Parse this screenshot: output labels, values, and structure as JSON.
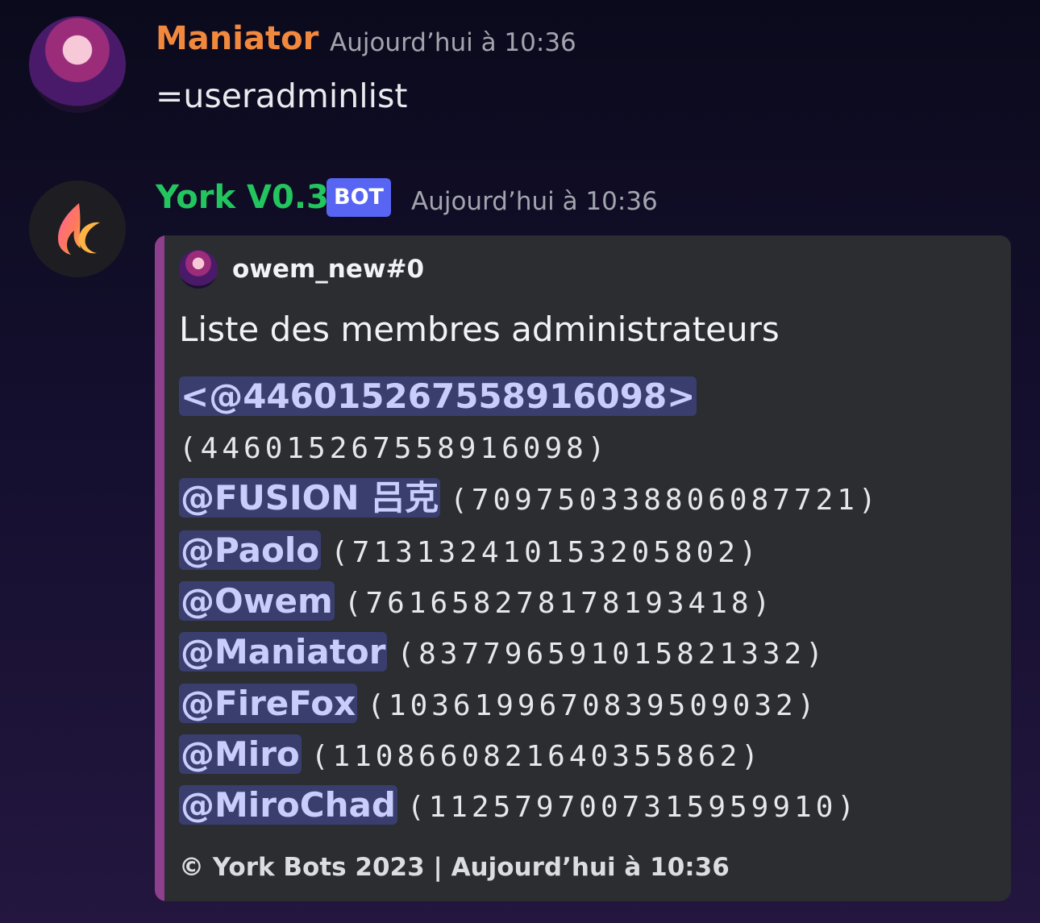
{
  "message_user": {
    "author": "Maniator",
    "timestamp": "Aujourd’hui à 10:36",
    "text": "=useradminlist"
  },
  "message_bot": {
    "author": "York V0.3",
    "badge": "BOT",
    "timestamp": "Aujourd’hui à 10:36"
  },
  "embed": {
    "author": "owem_new#0",
    "title": "Liste des membres administrateurs",
    "raw_mention": "<@446015267558916098>",
    "raw_id": "(446015267558916098)",
    "members": [
      {
        "mention": "@FUSION 吕克",
        "id": "(709750338806087721)"
      },
      {
        "mention": "@Paolo",
        "id": "(713132410153205802)"
      },
      {
        "mention": "@Owem",
        "id": "(761658278178193418)"
      },
      {
        "mention": "@Maniator",
        "id": "(837796591015821332)"
      },
      {
        "mention": "@FireFox",
        "id": "(1036199670839509032)"
      },
      {
        "mention": "@Miro",
        "id": "(1108660821640355862)"
      },
      {
        "mention": "@MiroChad",
        "id": "(1125797007315959910)"
      }
    ],
    "footer": "© York Bots 2023 | Aujourd’hui à 10:36"
  },
  "colors": {
    "user_name": "#f0883e",
    "bot_name": "#23c55e",
    "badge": "#5865f2",
    "embed_bar": "#8e3f8e",
    "embed_bg": "#2b2d31",
    "mention_text": "#c9cdfb"
  },
  "icons": {
    "user_avatar": "anime-avatar",
    "bot_avatar": "flame-logo-icon"
  }
}
